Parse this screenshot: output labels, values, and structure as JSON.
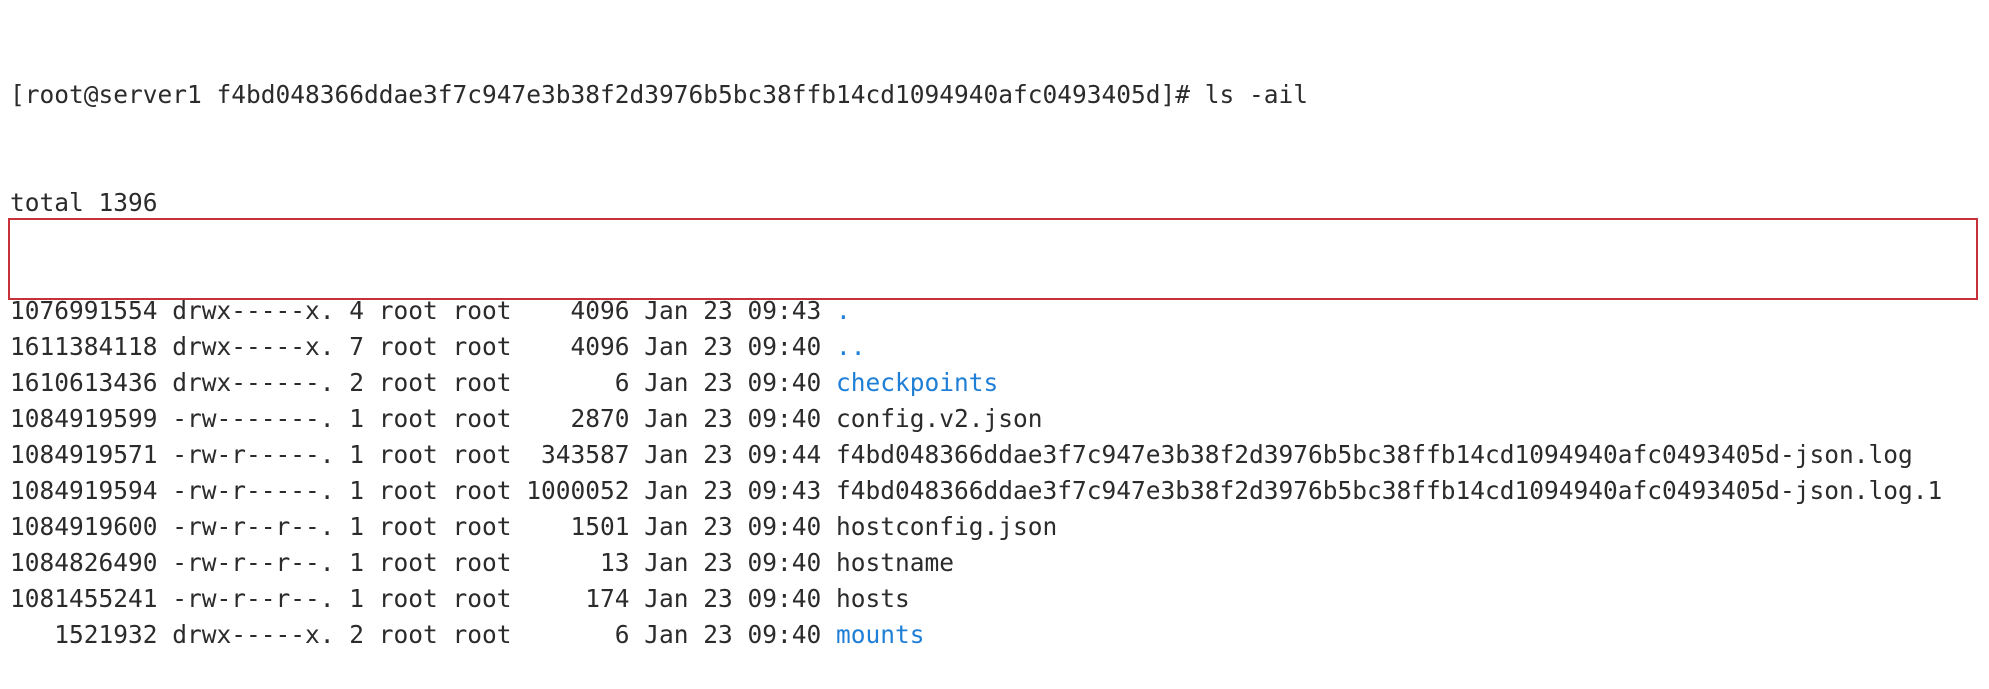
{
  "terminal": {
    "prompt": "[root@server1 f4bd048366ddae3f7c947e3b38f2d3976b5bc38ffb14cd1094940afc0493405d]# ls -ail",
    "total": "total 1396",
    "entries": [
      {
        "inode": "1076991554",
        "perms": "drwx-----x.",
        "links": "4",
        "owner": "root",
        "group": "root",
        "size": "4096",
        "date": "Jan 23 09:43",
        "name": ".",
        "is_dir": true
      },
      {
        "inode": "1611384118",
        "perms": "drwx-----x.",
        "links": "7",
        "owner": "root",
        "group": "root",
        "size": "4096",
        "date": "Jan 23 09:40",
        "name": "..",
        "is_dir": true
      },
      {
        "inode": "1610613436",
        "perms": "drwx------.",
        "links": "2",
        "owner": "root",
        "group": "root",
        "size": "6",
        "date": "Jan 23 09:40",
        "name": "checkpoints",
        "is_dir": true
      },
      {
        "inode": "1084919599",
        "perms": "-rw-------.",
        "links": "1",
        "owner": "root",
        "group": "root",
        "size": "2870",
        "date": "Jan 23 09:40",
        "name": "config.v2.json",
        "is_dir": false
      },
      {
        "inode": "1084919571",
        "perms": "-rw-r-----.",
        "links": "1",
        "owner": "root",
        "group": "root",
        "size": "343587",
        "date": "Jan 23 09:44",
        "name": "f4bd048366ddae3f7c947e3b38f2d3976b5bc38ffb14cd1094940afc0493405d-json.log",
        "is_dir": false
      },
      {
        "inode": "1084919594",
        "perms": "-rw-r-----.",
        "links": "1",
        "owner": "root",
        "group": "root",
        "size": "1000052",
        "date": "Jan 23 09:43",
        "name": "f4bd048366ddae3f7c947e3b38f2d3976b5bc38ffb14cd1094940afc0493405d-json.log.1",
        "is_dir": false
      },
      {
        "inode": "1084919600",
        "perms": "-rw-r--r--.",
        "links": "1",
        "owner": "root",
        "group": "root",
        "size": "1501",
        "date": "Jan 23 09:40",
        "name": "hostconfig.json",
        "is_dir": false
      },
      {
        "inode": "1084826490",
        "perms": "-rw-r--r--.",
        "links": "1",
        "owner": "root",
        "group": "root",
        "size": "13",
        "date": "Jan 23 09:40",
        "name": "hostname",
        "is_dir": false
      },
      {
        "inode": "1081455241",
        "perms": "-rw-r--r--.",
        "links": "1",
        "owner": "root",
        "group": "root",
        "size": "174",
        "date": "Jan 23 09:40",
        "name": "hosts",
        "is_dir": false
      },
      {
        "inode": "1521932",
        "perms": "drwx-----x.",
        "links": "2",
        "owner": "root",
        "group": "root",
        "size": "6",
        "date": "Jan 23 09:40",
        "name": "mounts",
        "is_dir": true
      }
    ]
  },
  "colors": {
    "text": "#2b2b2b",
    "directory": "#1f7fd6",
    "highlight_border": "#c8303a",
    "background": "#ffffff"
  }
}
